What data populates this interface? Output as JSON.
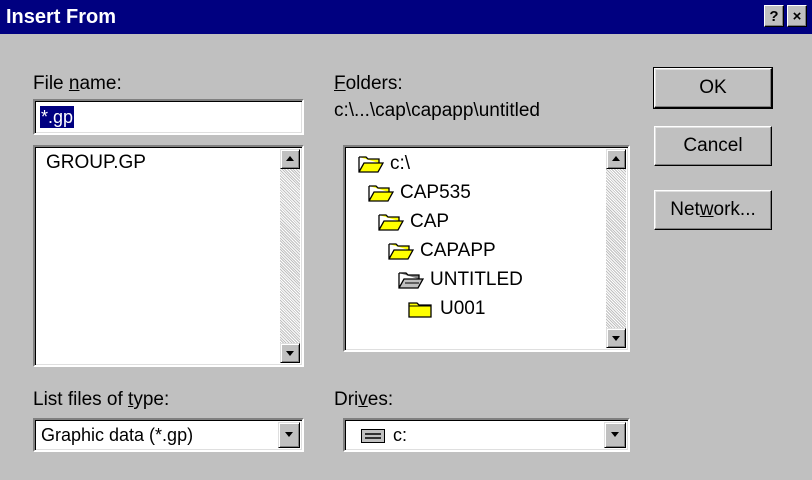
{
  "window": {
    "title": "Insert From"
  },
  "file_name": {
    "label_pre": "File ",
    "label_key": "n",
    "label_post": "ame:",
    "value": "*.gp",
    "files": [
      "GROUP.GP"
    ]
  },
  "folders": {
    "label_key": "F",
    "label_post": "olders:",
    "path": "c:\\...\\cap\\capapp\\untitled",
    "items": [
      {
        "label": "c:\\",
        "state": "open"
      },
      {
        "label": "CAP535",
        "state": "open"
      },
      {
        "label": "CAP",
        "state": "open"
      },
      {
        "label": "CAPAPP",
        "state": "open"
      },
      {
        "label": "UNTITLED",
        "state": "current"
      },
      {
        "label": "U001",
        "state": "closed"
      }
    ]
  },
  "buttons": {
    "ok": "OK",
    "cancel": "Cancel",
    "network_pre": "Net",
    "network_key": "w",
    "network_post": "ork..."
  },
  "file_type": {
    "label_pre": "List files of ",
    "label_key": "t",
    "label_post": "ype:",
    "value": "Graphic data (*.gp)"
  },
  "drives": {
    "label_pre": "Dri",
    "label_key": "v",
    "label_post": "es:",
    "value": "c:"
  },
  "title_buttons": {
    "help": "?",
    "close": "×"
  },
  "colors": {
    "title_bar": "#000080",
    "face": "#c0c0c0",
    "folder": "#ffff00"
  }
}
